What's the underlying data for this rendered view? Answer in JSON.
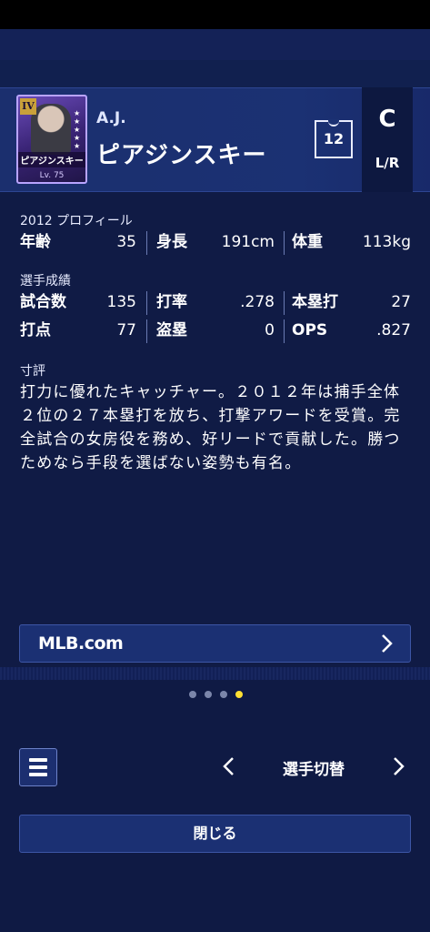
{
  "player": {
    "first_name": "A.J.",
    "last_name": "ピアジンスキー",
    "card_name": "ピアジンスキー",
    "card_level": "Lv. 75",
    "card_rank": "IV",
    "uniform_number": "12",
    "position": "C",
    "bats_throws": "L/R"
  },
  "profile": {
    "heading": "2012 プロフィール",
    "age_label": "年齢",
    "age_value": "35",
    "height_label": "身長",
    "height_value": "191cm",
    "weight_label": "体重",
    "weight_value": "113kg"
  },
  "stats": {
    "heading": "選手成績",
    "games_label": "試合数",
    "games_value": "135",
    "avg_label": "打率",
    "avg_value": ".278",
    "hr_label": "本塁打",
    "hr_value": "27",
    "rbi_label": "打点",
    "rbi_value": "77",
    "sb_label": "盗塁",
    "sb_value": "0",
    "ops_label": "OPS",
    "ops_value": ".827"
  },
  "review": {
    "heading": "寸評",
    "text": "打力に優れたキャッチャー。２０１２年は捕手全体２位の２７本塁打を放ち、打撃アワードを受賞。完全試合の女房役を務め、好リードで貢献した。勝つためなら手段を選ばない姿勢も有名。"
  },
  "link": {
    "label": "MLB.com"
  },
  "pager": {
    "count": 4,
    "active": 4
  },
  "footer": {
    "switch_label": "選手切替",
    "close_label": "閉じる"
  },
  "colors": {
    "background": "#101b45",
    "header": "#1b3173",
    "button": "#1b3073",
    "active_dot": "#ffe033"
  },
  "icons": {
    "menu": "menu-icon",
    "prev": "chevron-left-icon",
    "next": "chevron-right-icon",
    "link_arrow": "chevron-right-icon"
  }
}
